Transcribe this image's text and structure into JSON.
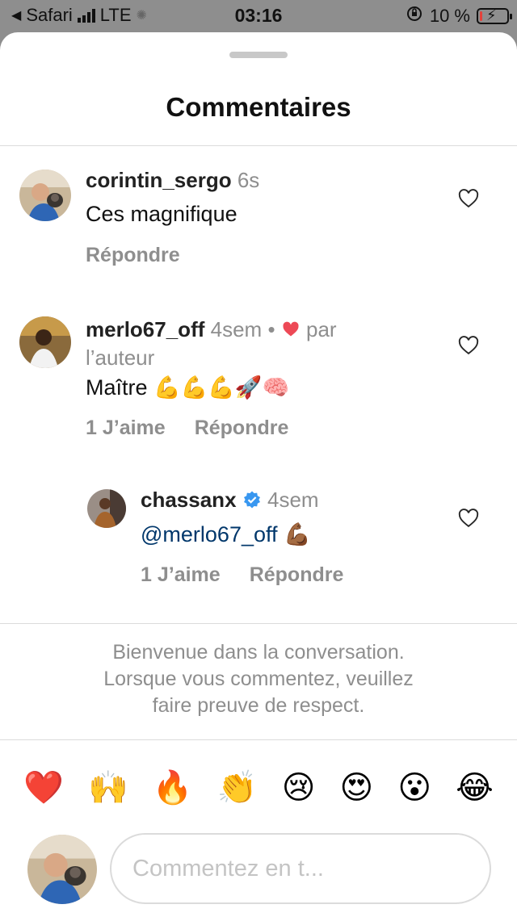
{
  "status": {
    "carrier": "Safari",
    "network": "LTE",
    "time": "03:16",
    "battery_percent": "10 %",
    "battery_level": 0.1
  },
  "sheet": {
    "title": "Commentaires"
  },
  "comments": [
    {
      "username": "corintin_sergo",
      "time": "6s",
      "text": "Ces magnifique",
      "reply_label": "Répondre"
    },
    {
      "username": "merlo67_off",
      "time": "4sem",
      "separator": "•",
      "liked_by_author": "par l’auteur",
      "text": "Maître 💪💪💪🚀🧠",
      "likes_label": "1 J’aime",
      "reply_label": "Répondre"
    },
    {
      "username": "chassanx",
      "verified": true,
      "time": "4sem",
      "mention": "@merlo67_off",
      "emoji": "💪🏾",
      "likes_label": "1 J’aime",
      "reply_label": "Répondre"
    }
  ],
  "welcome": {
    "line1": "Bienvenue dans la conversation.",
    "line2": "Lorsque vous commentez, veuillez",
    "line3": "faire preuve de respect."
  },
  "emoji_bar": [
    "❤️",
    "🙌",
    "🔥",
    "👏",
    "😢",
    "😍",
    "😮",
    "😂"
  ],
  "composer": {
    "placeholder": "Commentez en t..."
  },
  "colors": {
    "mention": "#00376b",
    "like_heart": "#ed4956",
    "verified": "#3897f0",
    "muted": "#8e8e8e"
  }
}
